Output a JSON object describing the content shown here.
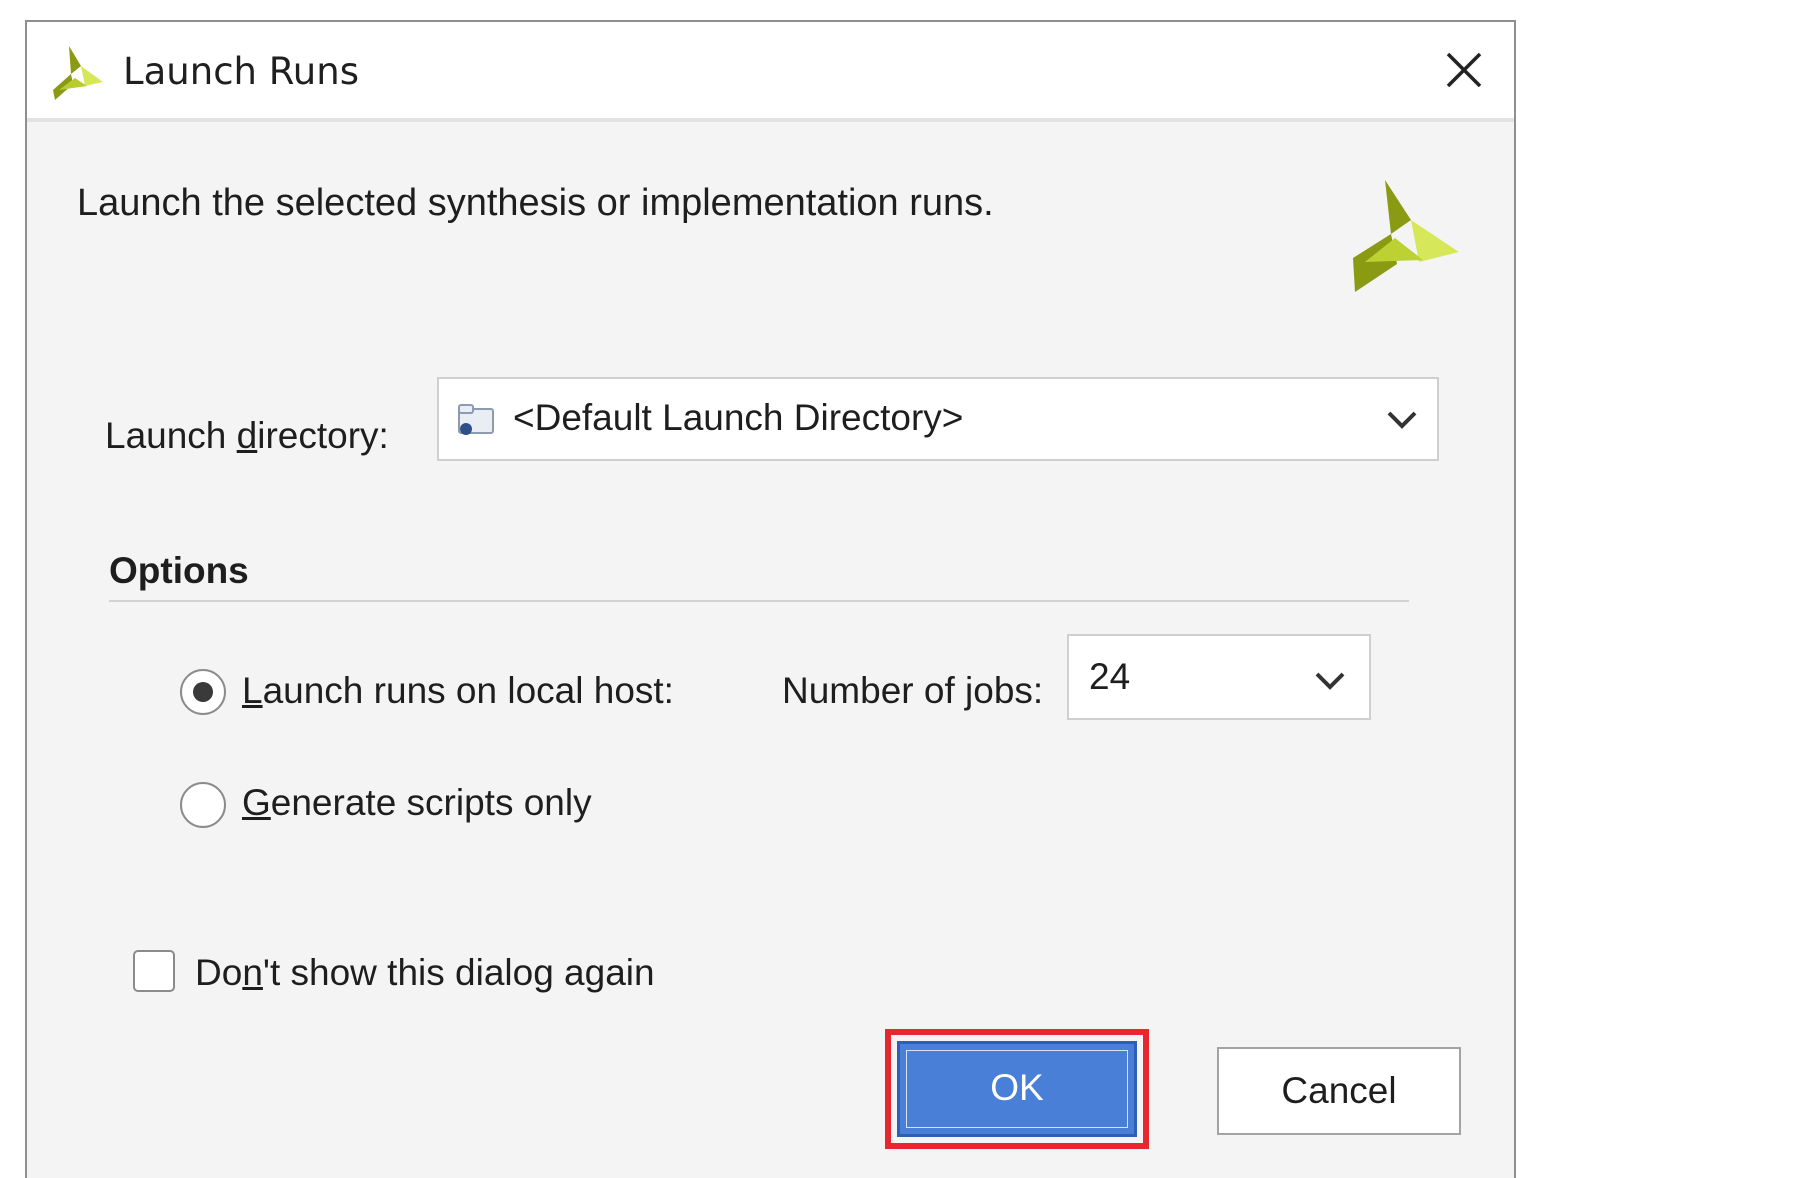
{
  "window": {
    "title": "Launch Runs",
    "close_icon": "close-icon",
    "app_icon": "xilinx-logo-icon"
  },
  "description": "Launch the selected synthesis or implementation runs.",
  "launch_directory": {
    "label_before": "Launch ",
    "label_mnemonic": "d",
    "label_after": "irectory:",
    "value": "<Default Launch Directory>",
    "icon": "folder-icon"
  },
  "options": {
    "title": "Options",
    "local_host": {
      "label_mnemonic": "L",
      "label_rest": "aunch runs on local host:",
      "selected": true
    },
    "jobs": {
      "label_before": "Number of ",
      "label_mnemonic": "j",
      "label_after": "obs:",
      "value": "24"
    },
    "scripts_only": {
      "label_mnemonic": "G",
      "label_rest": "enerate scripts only",
      "selected": false
    }
  },
  "dont_show": {
    "label_before": "Do",
    "label_mnemonic": "n",
    "label_after": "'t show this dialog again",
    "checked": false
  },
  "buttons": {
    "ok": "OK",
    "cancel": "Cancel"
  },
  "colors": {
    "ok_button": "#4a7fd7",
    "highlight": "#e8262f",
    "logo_dark": "#8a9a12",
    "logo_light": "#d6e85a"
  }
}
